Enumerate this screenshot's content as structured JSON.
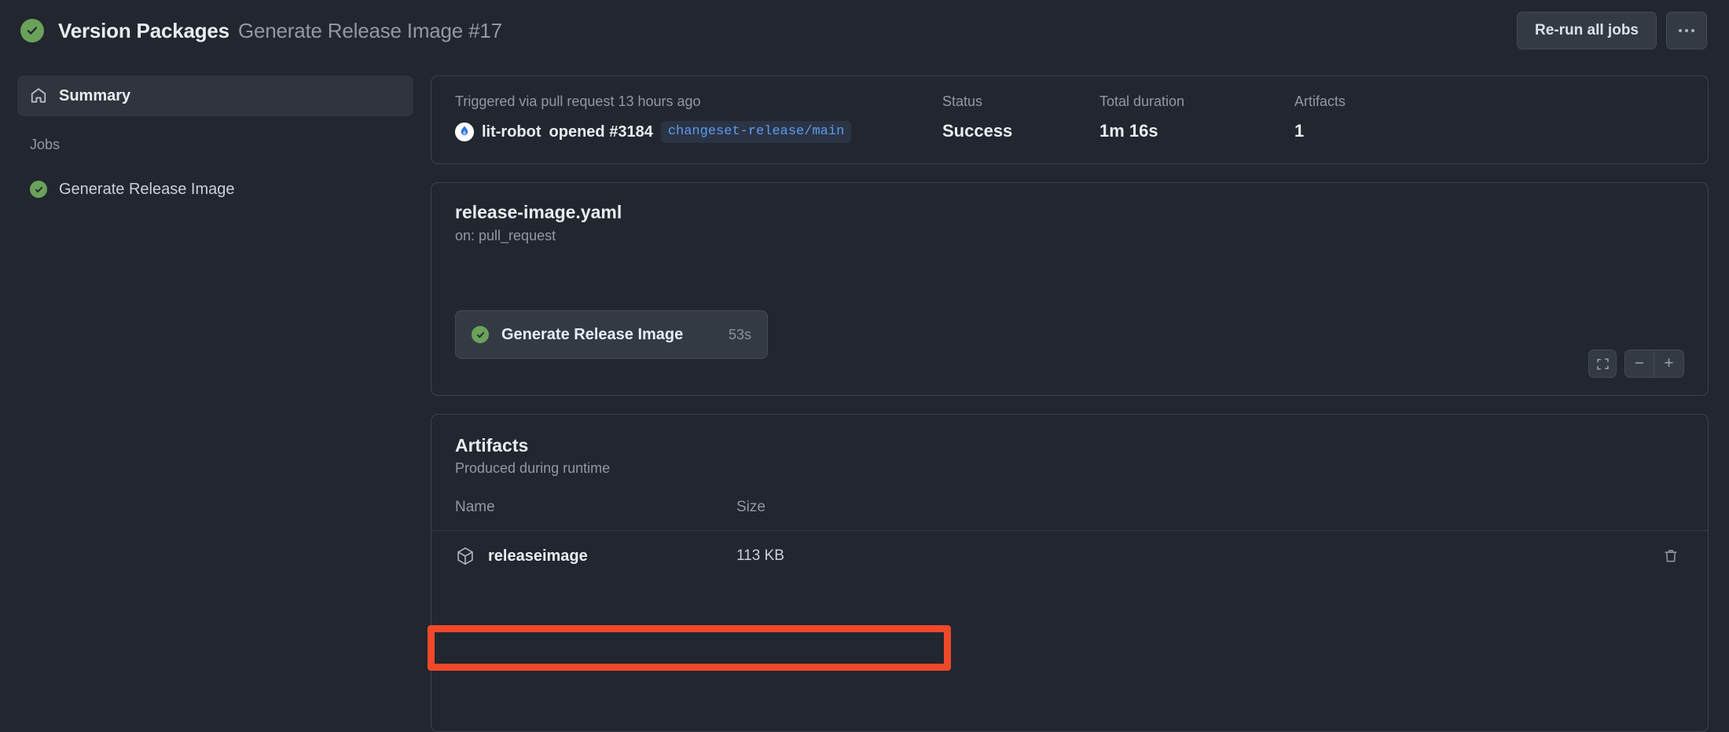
{
  "header": {
    "status_icon": "check-circle-icon",
    "title": "Version Packages",
    "subtitle": "Generate Release Image #17",
    "rerun_label": "Re-run all jobs",
    "kebab_label": "More options"
  },
  "sidebar": {
    "summary": {
      "icon": "home-icon",
      "label": "Summary"
    },
    "jobs_section_label": "Jobs",
    "jobs": [
      {
        "label": "Generate Release Image",
        "status_icon": "check-circle-icon"
      }
    ]
  },
  "info": {
    "trigger_note": "Triggered via pull request 13 hours ago",
    "actor": "lit-robot",
    "action_text": "opened #3184",
    "branch": "changeset-release/main",
    "status_label": "Status",
    "status_value": "Success",
    "duration_label": "Total duration",
    "duration_value": "1m 16s",
    "artifacts_label": "Artifacts",
    "artifacts_value": "1"
  },
  "workflow": {
    "file_name": "release-image.yaml",
    "trigger": "on: pull_request",
    "job_node": {
      "label": "Generate Release Image",
      "duration": "53s",
      "status_icon": "check-circle-icon"
    },
    "controls": {
      "fit_icon": "fit-to-screen-icon",
      "zoom_out": "−",
      "zoom_in": "+"
    }
  },
  "artifacts": {
    "title": "Artifacts",
    "subtitle": "Produced during runtime",
    "columns": [
      "Name",
      "Size"
    ],
    "rows": [
      {
        "icon": "package-icon",
        "name": "releaseimage",
        "size": "113 KB",
        "delete_icon": "trash-icon",
        "highlighted": true
      }
    ]
  },
  "colors": {
    "page_background": "#22262e",
    "card_border": "#3b414c",
    "success_green": "#6aa259",
    "branch_blue": "#5d9bf0",
    "highlight_red": "#f0482a",
    "muted_text": "#9099a5"
  }
}
